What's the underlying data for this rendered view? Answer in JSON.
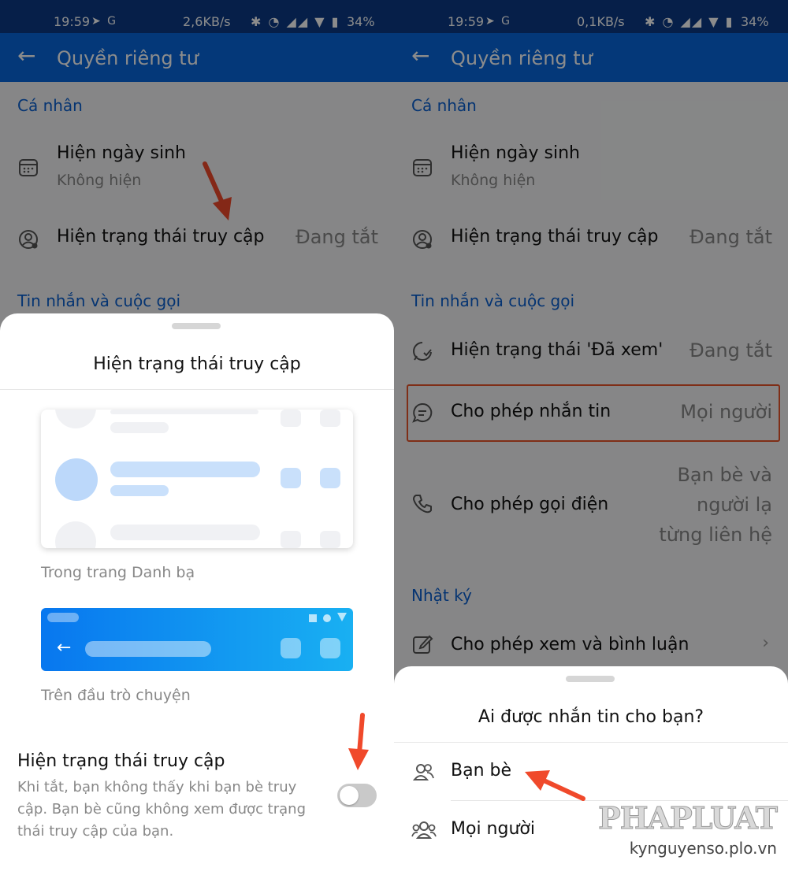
{
  "status_left": {
    "time": "19:59",
    "net_speed": "2,6KB/s",
    "battery": "34%"
  },
  "status_right": {
    "time": "19:59",
    "net_speed": "0,1KB/s",
    "battery": "34%"
  },
  "header": {
    "back": "←",
    "title": "Quyền riêng tư"
  },
  "sections": {
    "personal": "Cá nhân",
    "messages": "Tin nhắn và cuộc gọi",
    "diary": "Nhật ký"
  },
  "rows": {
    "birthday": {
      "label": "Hiện ngày sinh",
      "sub": "Không hiện",
      "icon": "calendar-icon"
    },
    "access_status": {
      "label": "Hiện trạng thái truy cập",
      "value": "Đang tắt",
      "icon": "user-status-icon"
    },
    "seen_status": {
      "label": "Hiện trạng thái 'Đã xem'",
      "value": "Đang tắt",
      "icon": "seen-chat-icon"
    },
    "allow_messages": {
      "label": "Cho phép nhắn tin",
      "value": "Mọi người",
      "icon": "chat-bubble-icon"
    },
    "allow_calls": {
      "label": "Cho phép gọi điện",
      "value_lines": [
        "Bạn bè và",
        "người lạ",
        "từng liên hệ"
      ],
      "icon": "phone-icon"
    },
    "allow_diary": {
      "label": "Cho phép xem và bình luận",
      "icon": "edit-icon"
    }
  },
  "left_sheet": {
    "title": "Hiện trạng thái truy cập",
    "caption_contacts": "Trong trang Danh bạ",
    "caption_chat": "Trên đầu trò chuyện",
    "toggle_title": "Hiện trạng thái truy cập",
    "toggle_desc": "Khi tắt, bạn không thấy khi bạn bè truy cập. Bạn bè cũng không xem được trạng thái truy cập của bạn.",
    "toggle_on": false
  },
  "right_sheet": {
    "title": "Ai được nhắn tin cho bạn?",
    "options": [
      {
        "label": "Bạn bè",
        "icon": "friends-icon"
      },
      {
        "label": "Mọi người",
        "icon": "group-icon"
      }
    ]
  },
  "watermark": {
    "brand": "PHAPLUAT",
    "site": "kynguyenso.plo.vn"
  },
  "colors": {
    "accent": "#0867dc",
    "status_bar": "#0b3a86",
    "highlight": "#e8542a",
    "arrow": "#f0492b"
  }
}
